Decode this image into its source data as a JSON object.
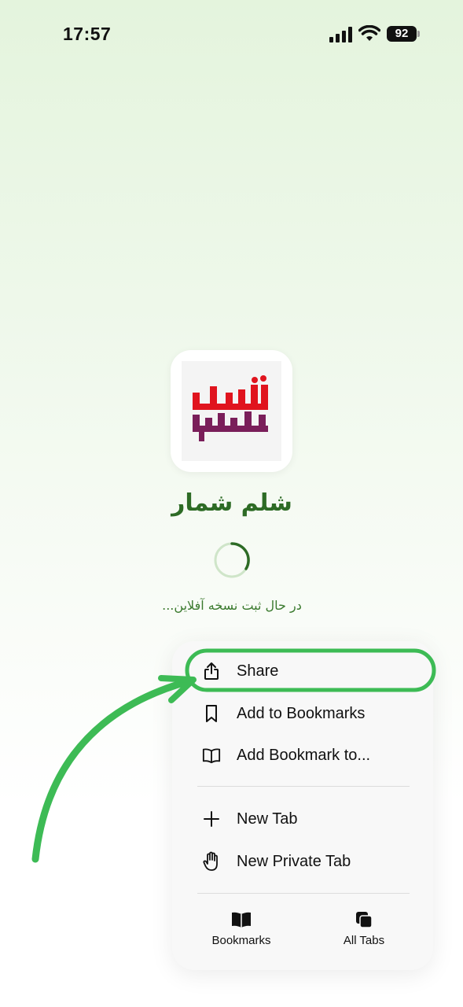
{
  "status_bar": {
    "time": "17:57",
    "battery": "92",
    "icons": [
      "signal-icon",
      "wifi-icon",
      "battery-icon"
    ]
  },
  "app": {
    "logo_text": "شلم شمار",
    "name": "شلم شمار",
    "loading_text": "در حال ثبت نسخه آفلاین..."
  },
  "menu": {
    "items": [
      {
        "label": "Share",
        "icon": "share-icon"
      },
      {
        "label": "Add to Bookmarks",
        "icon": "bookmark-icon"
      },
      {
        "label": "Add Bookmark to...",
        "icon": "book-open-icon"
      },
      {
        "label": "New Tab",
        "icon": "plus-icon"
      },
      {
        "label": "New Private Tab",
        "icon": "hand-icon"
      }
    ],
    "bottom": [
      {
        "label": "Bookmarks",
        "icon": "bookmarks-book-icon"
      },
      {
        "label": "All Tabs",
        "icon": "tabs-icon"
      }
    ]
  },
  "colors": {
    "brand_green": "#2d6b25",
    "annotation_green": "#3dbb55",
    "logo_red": "#e0141e",
    "logo_purple": "#7a1e5a"
  }
}
